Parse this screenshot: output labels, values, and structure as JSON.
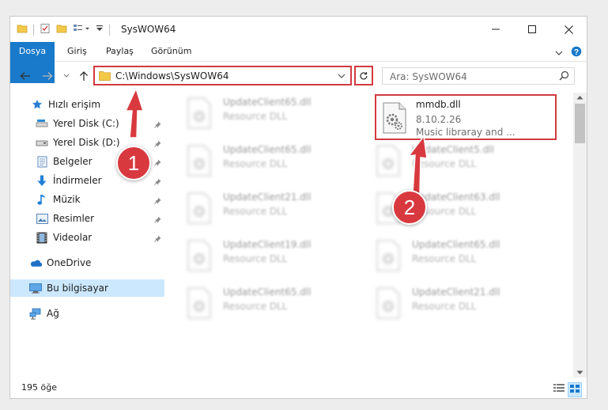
{
  "window": {
    "title": "SysWOW64",
    "controls": [
      "minimize-icon",
      "maximize-icon",
      "close-icon"
    ]
  },
  "ribbon": {
    "tabs": [
      "Dosya",
      "Giriş",
      "Paylaş",
      "Görünüm"
    ],
    "accent": "#1979ca"
  },
  "address": {
    "path": "C:\\Windows\\SysWOW64",
    "search_placeholder": "Ara: SysWOW64"
  },
  "sidebar": {
    "quick_access": "Hızlı erişim",
    "items": [
      {
        "label": "Yerel Disk (C:)",
        "icon": "drive-icon",
        "pinned": true
      },
      {
        "label": "Yerel Disk (D:)",
        "icon": "drive-icon",
        "pinned": true
      },
      {
        "label": "Belgeler",
        "icon": "documents-icon",
        "pinned": true
      },
      {
        "label": "İndirmeler",
        "icon": "downloads-icon",
        "pinned": true
      },
      {
        "label": "Müzik",
        "icon": "music-icon",
        "pinned": true
      },
      {
        "label": "Resimler",
        "icon": "pictures-icon",
        "pinned": true
      },
      {
        "label": "Videolar",
        "icon": "videos-icon",
        "pinned": true
      }
    ],
    "onedrive": "OneDrive",
    "this_pc": "Bu bilgisayar",
    "network": "Ağ"
  },
  "files": [
    {
      "name": "UpdateClient65.dll",
      "type": "Resource DLL"
    },
    {
      "name": "UpdateClient65.dll",
      "type": "Resource DLL"
    },
    {
      "name": "UpdateClient5.dll",
      "type": "Resource DLL"
    },
    {
      "name": "UpdateClient21.dll",
      "type": "Resource DLL"
    },
    {
      "name": "UpdateClient63.dll",
      "type": "Resource DLL"
    },
    {
      "name": "UpdateClient19.dll",
      "type": "Resource DLL"
    },
    {
      "name": "UpdateClient65.dll",
      "type": "Resource DLL"
    },
    {
      "name": "UpdateClient65.dll",
      "type": "Resource DLL"
    },
    {
      "name": "UpdateClient21.dll",
      "type": "Resource DLL"
    }
  ],
  "highlighted_file": {
    "name": "mmdb.dll",
    "version": "8.10.2.26",
    "description": "Music libraray and ..."
  },
  "status": {
    "count": "195 öğe"
  },
  "callouts": {
    "step1": "1",
    "step2": "2",
    "color": "#d8393f"
  }
}
